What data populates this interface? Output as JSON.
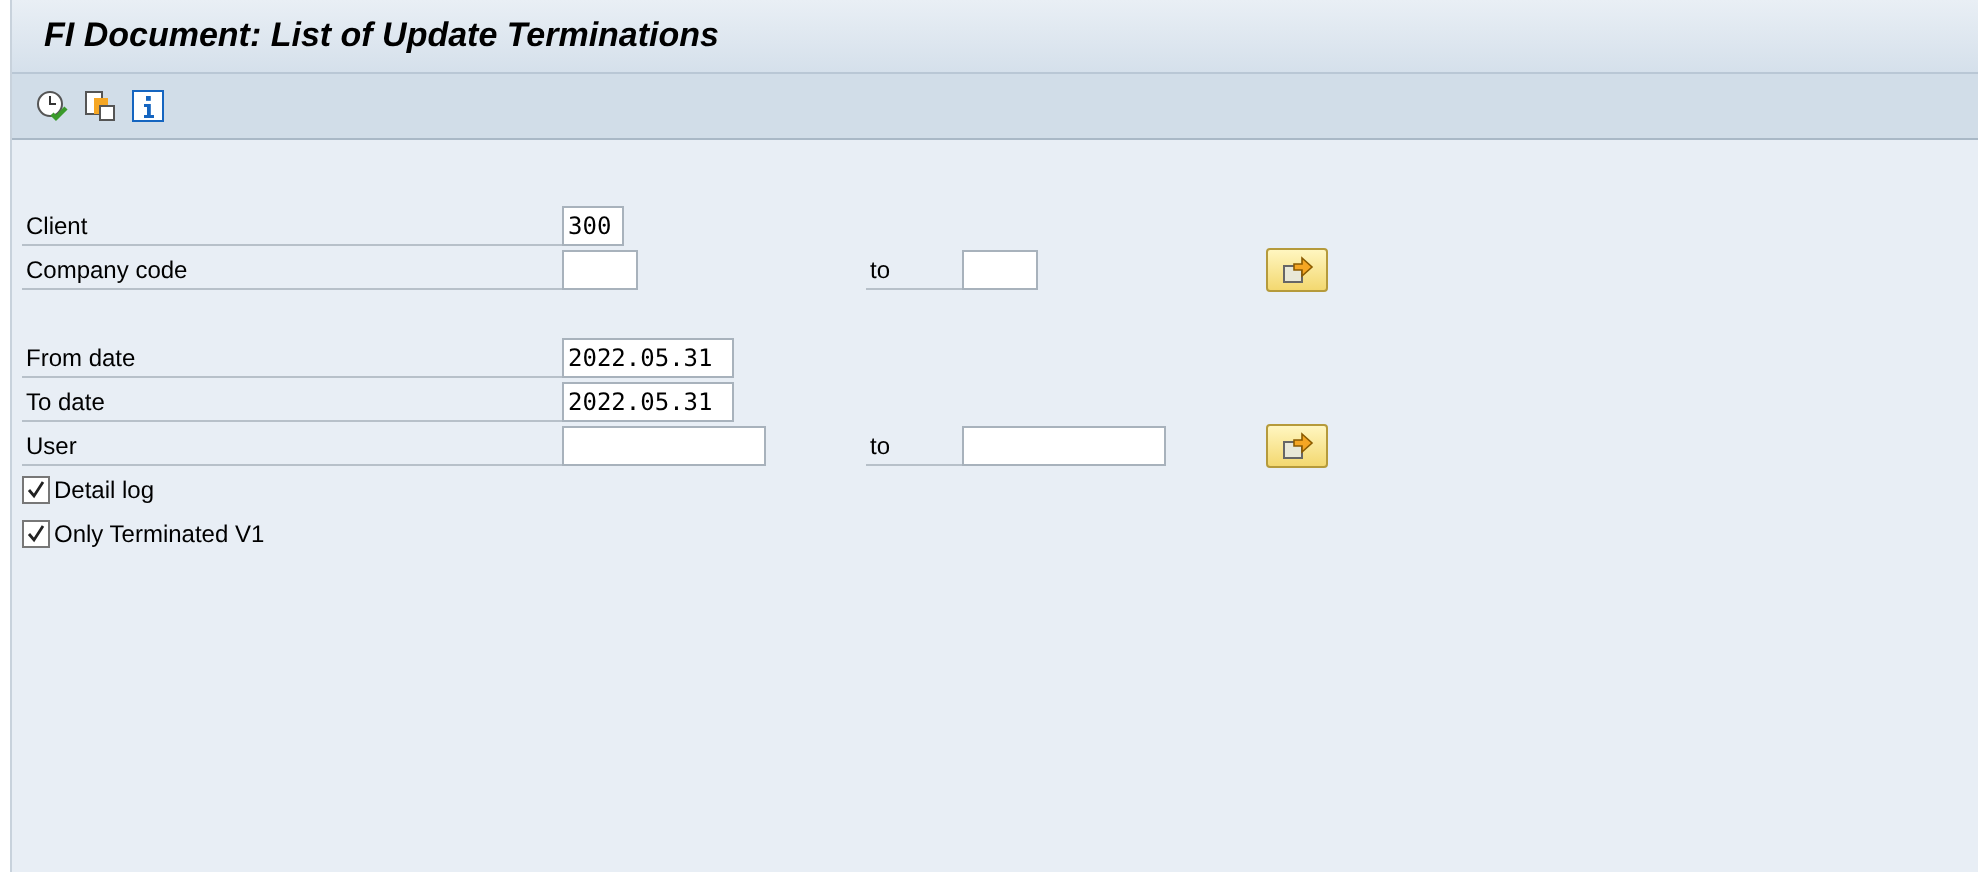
{
  "window": {
    "title": "FI Document: List of Update Terminations"
  },
  "toolbar": {
    "buttons": [
      {
        "kind": "execute"
      },
      {
        "kind": "variant"
      },
      {
        "kind": "info"
      }
    ]
  },
  "sections": [
    [
      {
        "kind": "field",
        "label": "Client",
        "value": "300"
      },
      {
        "kind": "range",
        "label": "Company code",
        "to_label": "to"
      }
    ],
    [
      {
        "kind": "field",
        "label": "From date",
        "value": "2022.05.31"
      },
      {
        "kind": "field",
        "label": "To date",
        "value": "2022.05.31"
      },
      {
        "kind": "range",
        "label": "User",
        "to_label": "to"
      },
      {
        "kind": "checkbox",
        "label": "Detail log",
        "checked": true
      },
      {
        "kind": "checkbox",
        "label": "Only Terminated V1",
        "checked": true
      }
    ]
  ]
}
